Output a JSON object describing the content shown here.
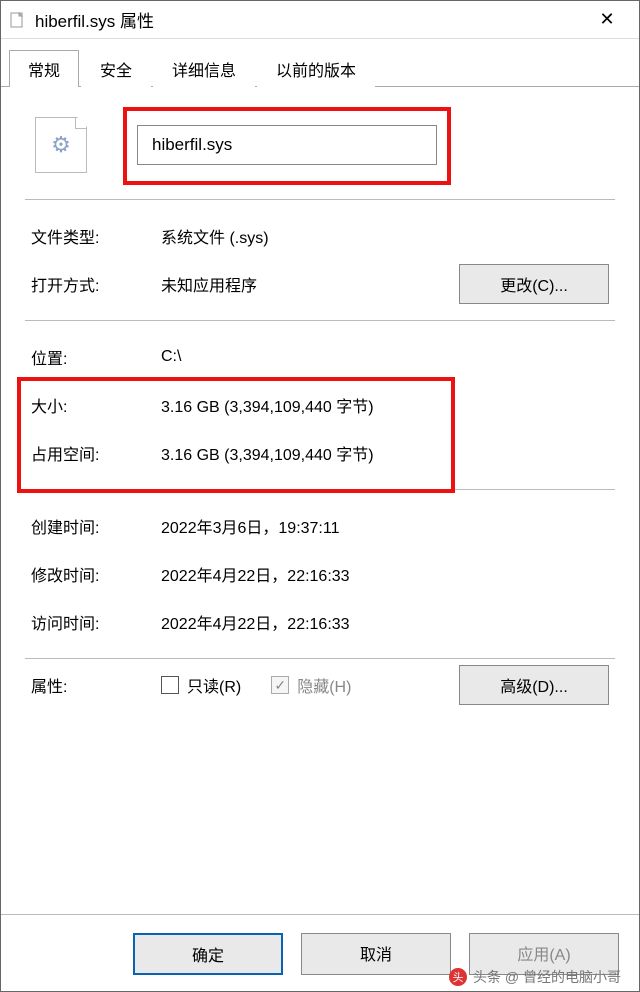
{
  "window_title": "hiberfil.sys 属性",
  "tabs": {
    "general": "常规",
    "security": "安全",
    "details": "详细信息",
    "previous": "以前的版本"
  },
  "file_name": "hiberfil.sys",
  "labels": {
    "file_type": "文件类型:",
    "opens_with": "打开方式:",
    "change_btn": "更改(C)...",
    "location": "位置:",
    "size": "大小:",
    "size_on_disk": "占用空间:",
    "created": "创建时间:",
    "modified": "修改时间:",
    "accessed": "访问时间:",
    "attributes": "属性:",
    "readonly": "只读(R)",
    "hidden": "隐藏(H)",
    "advanced_btn": "高级(D)..."
  },
  "values": {
    "file_type": "系统文件 (.sys)",
    "opens_with": "未知应用程序",
    "location": "C:\\",
    "size": "3.16 GB (3,394,109,440 字节)",
    "size_on_disk": "3.16 GB (3,394,109,440 字节)",
    "created": "2022年3月6日，19:37:11",
    "modified": "2022年4月22日，22:16:33",
    "accessed": "2022年4月22日，22:16:33"
  },
  "buttons": {
    "ok": "确定",
    "cancel": "取消",
    "apply": "应用(A)"
  },
  "watermark": "头条 @ 曾经的电脑小哥",
  "checkmark": "✓"
}
